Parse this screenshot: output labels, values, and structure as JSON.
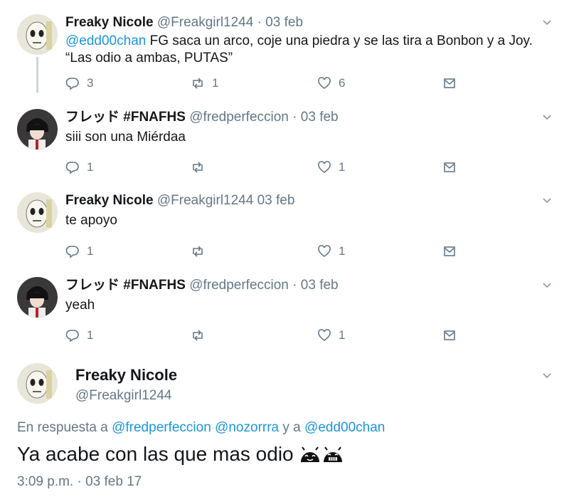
{
  "tweets": [
    {
      "name": "Freaky Nicole",
      "handle": "@Freakgirl1244",
      "date": "· 03 feb",
      "mention": "@edd00chan",
      "text_after_mention": " FG saca un arco, coje una piedra y se las tira a Bonbon y a Joy.",
      "text_line2": "“Las odio a ambas, PUTAS”",
      "replies": "3",
      "retweets": "1",
      "likes": "6"
    },
    {
      "name": "フレッド #FNAFHS",
      "handle": "@fredperfeccion",
      "date": "· 03 feb",
      "text": "siii son una Miérdaa",
      "replies": "1",
      "retweets": "",
      "likes": "1"
    },
    {
      "name": "Freaky Nicole",
      "handle": "@Freakgirl1244",
      "date": "03 feb",
      "text": "te apoyo",
      "replies": "1",
      "retweets": "",
      "likes": "1"
    },
    {
      "name": "フレッド #FNAFHS",
      "handle": "@fredperfeccion",
      "date": "· 03 feb",
      "text": "yeah",
      "replies": "1",
      "retweets": "",
      "likes": "1"
    }
  ],
  "focused": {
    "name": "Freaky Nicole",
    "handle": "@Freakgirl1244",
    "reply_prefix": "En respuesta a",
    "reply_mentions": [
      "@fredperfeccion",
      "@nozorrra"
    ],
    "reply_joiner": "y a",
    "reply_last": "@edd00chan",
    "text": "Ya acabe con las que mas odio",
    "emoji_icons": [
      "android-face-icon",
      "android-face-grin-icon"
    ],
    "timestamp": "3:09 p.m. · 03 feb 17"
  },
  "colors": {
    "link": "#1b95e0",
    "secondary": "#657786",
    "thread_line": "#ccd6dd"
  },
  "icons": {
    "reply": "reply-icon",
    "retweet": "retweet-icon",
    "like": "heart-icon",
    "dm": "envelope-icon",
    "menu": "chevron-down-icon"
  }
}
